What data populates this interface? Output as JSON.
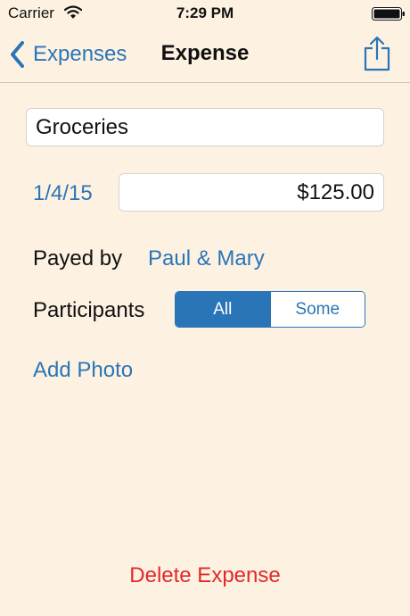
{
  "status_bar": {
    "carrier": "Carrier",
    "time": "7:29 PM",
    "icons": [
      "wifi-icon",
      "battery-icon"
    ]
  },
  "nav": {
    "back_label": "Expenses",
    "title": "Expense",
    "share_icon": "share-icon"
  },
  "form": {
    "name_value": "Groceries",
    "date": "1/4/15",
    "amount_value": "$125.00",
    "payed_by_label": "Payed by",
    "payer": "Paul & Mary",
    "participants_label": "Participants",
    "participants_options": [
      "All",
      "Some"
    ],
    "participants_selected": "All",
    "add_photo_label": "Add Photo"
  },
  "footer": {
    "delete_label": "Delete Expense"
  },
  "colors": {
    "background": "#fdf2e1",
    "accent": "#2a75b8",
    "destructive": "#e0292a"
  }
}
